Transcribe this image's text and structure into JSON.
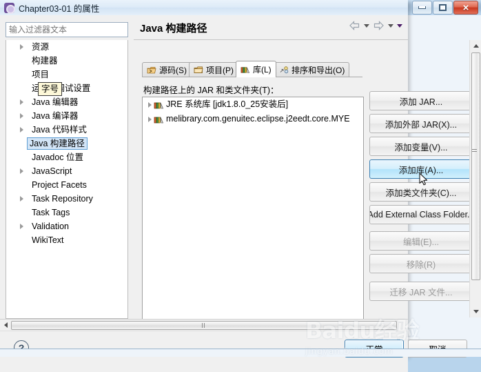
{
  "window": {
    "dialog_title": "Chapter03-01 的属性",
    "dialog_icon": "properties-icon",
    "controls": {
      "minimize": "minimize-icon",
      "maximize": "maximize-icon",
      "close": "×"
    }
  },
  "filter": {
    "placeholder": "输入过滤器文本",
    "value": ""
  },
  "tooltip": {
    "text": "字号"
  },
  "tree": {
    "items": [
      {
        "label": "资源",
        "expandable": true,
        "indent": 1,
        "selected": false
      },
      {
        "label": "构建器",
        "expandable": false,
        "indent": 1,
        "selected": false
      },
      {
        "label": "项目",
        "expandable": false,
        "indent": 1,
        "selected": false
      },
      {
        "label": "运行 / 调试设置",
        "expandable": false,
        "indent": 1,
        "selected": false
      },
      {
        "label": "Java 编辑器",
        "expandable": true,
        "indent": 1,
        "selected": false
      },
      {
        "label": "Java 编译器",
        "expandable": true,
        "indent": 1,
        "selected": false
      },
      {
        "label": "Java 代码样式",
        "expandable": true,
        "indent": 1,
        "selected": false
      },
      {
        "label": "Java 构建路径",
        "expandable": false,
        "indent": 1,
        "selected": true
      },
      {
        "label": "Javadoc 位置",
        "expandable": false,
        "indent": 1,
        "selected": false
      },
      {
        "label": "JavaScript",
        "expandable": true,
        "indent": 1,
        "selected": false
      },
      {
        "label": "Project Facets",
        "expandable": false,
        "indent": 1,
        "selected": false
      },
      {
        "label": "Task Repository",
        "expandable": true,
        "indent": 1,
        "selected": false
      },
      {
        "label": "Task Tags",
        "expandable": false,
        "indent": 1,
        "selected": false
      },
      {
        "label": "Validation",
        "expandable": true,
        "indent": 1,
        "selected": false
      },
      {
        "label": "WikiText",
        "expandable": false,
        "indent": 1,
        "selected": false
      }
    ]
  },
  "main": {
    "page_title": "Java 构建路径",
    "nav": {
      "back_icon": "back-arrow-icon",
      "back_caret": "chevron-down-icon",
      "forward_icon": "forward-arrow-icon",
      "forward_caret": "chevron-down-icon",
      "menu_caret": "view-menu-chevron-icon"
    },
    "tabs": [
      {
        "label": "源码(S)",
        "icon": "source-folder-icon",
        "active": false
      },
      {
        "label": "项目(P)",
        "icon": "project-folder-icon",
        "active": false
      },
      {
        "label": "库(L)",
        "icon": "library-icon",
        "active": true
      },
      {
        "label": "排序和导出(O)",
        "icon": "order-export-icon",
        "active": false
      }
    ],
    "list_caption": "构建路径上的 JAR 和类文件夹(T)：",
    "entries": [
      {
        "label": "JRE 系统库 [jdk1.8.0_25安装后]",
        "icon": "library-icon",
        "expandable": true
      },
      {
        "label": "melibrary.com.genuitec.eclipse.j2eedt.core.MYE",
        "icon": "library-icon",
        "expandable": true
      }
    ],
    "buttons": [
      {
        "label": "添加 JAR...",
        "state": "normal"
      },
      {
        "label": "添加外部 JAR(X)...",
        "state": "normal"
      },
      {
        "label": "添加变量(V)...",
        "state": "normal"
      },
      {
        "label": "添加库(A)...",
        "state": "hover"
      },
      {
        "label": "添加类文件夹(C)...",
        "state": "normal"
      },
      {
        "label": "Add External Class Folder...",
        "state": "normal"
      },
      {
        "label": "编辑(E)...",
        "state": "disabled"
      },
      {
        "label": "移除(R)",
        "state": "disabled"
      },
      {
        "label": "迁移 JAR 文件...",
        "state": "disabled"
      }
    ]
  },
  "footer": {
    "help_label": "?",
    "ok_label": "正常",
    "cancel_label": "取消"
  },
  "watermark": {
    "main": "Baidu经验",
    "sub": "jingyan.baidu.com"
  }
}
